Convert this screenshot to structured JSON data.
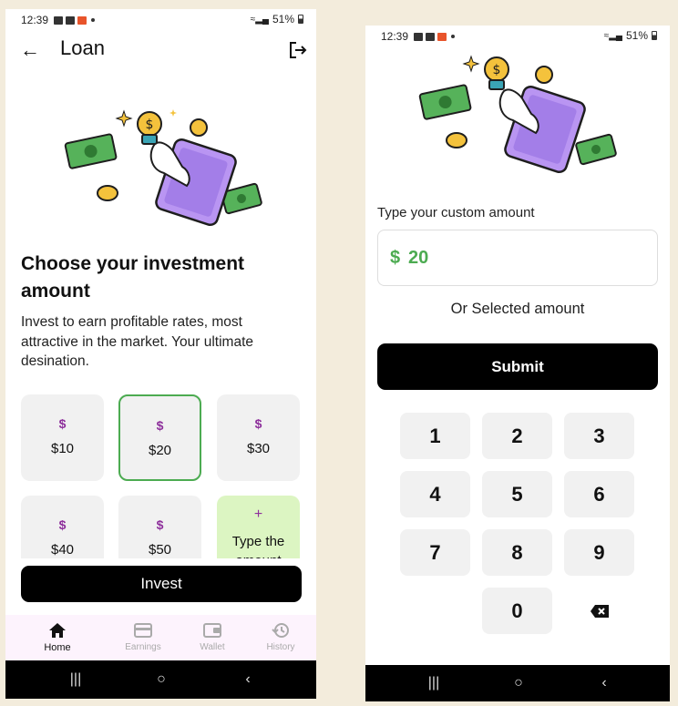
{
  "status_left": {
    "time": "12:39"
  },
  "status_right": {
    "battery": "51%"
  },
  "loan_screen": {
    "title": "Loan",
    "heading": "Choose your investment amount",
    "description": "Invest to earn profitable rates, most attractive in the market. Your ultimate desination.",
    "currency_symbol": "$",
    "amounts": [
      "$10",
      "$20",
      "$30",
      "$40",
      "$50"
    ],
    "selected_amount": "$20",
    "custom_plus": "+",
    "custom_label": "Type the amount",
    "invest_label": "Invest",
    "nav": [
      {
        "label": "Home",
        "icon": "home-icon",
        "active": true
      },
      {
        "label": "Earnings",
        "icon": "card-icon",
        "active": false
      },
      {
        "label": "Wallet",
        "icon": "wallet-icon",
        "active": false
      },
      {
        "label": "History",
        "icon": "history-icon",
        "active": false
      }
    ]
  },
  "custom_screen": {
    "prompt": "Type your custom amount",
    "currency_symbol": "$",
    "amount_value": "20",
    "or_label": "Or Selected amount",
    "submit_label": "Submit",
    "keypad": [
      "1",
      "2",
      "3",
      "4",
      "5",
      "6",
      "7",
      "8",
      "9",
      "0"
    ]
  },
  "colors": {
    "accent_green": "#4cab51",
    "accent_purple": "#8d2f9b",
    "custom_card_bg": "#dcf5c2",
    "nav_bg": "#fdf3fd"
  }
}
